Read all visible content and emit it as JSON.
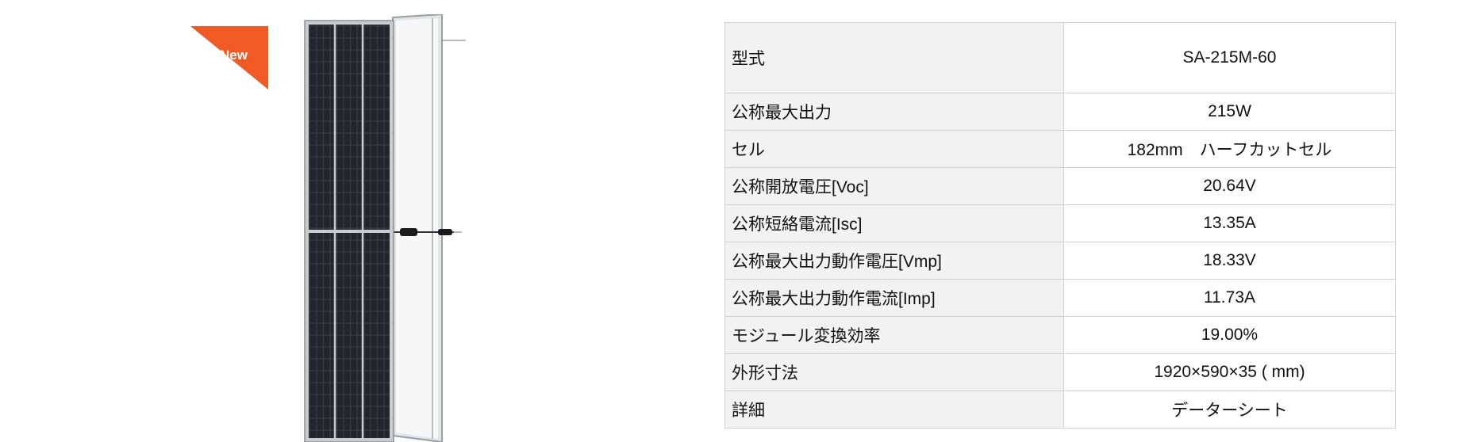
{
  "badge": {
    "text": "New",
    "color": "#f15a24"
  },
  "product_image": {
    "description_icon": "solar-panel-icon"
  },
  "specs": [
    {
      "label": "型式",
      "value": "SA-215M-60"
    },
    {
      "label": "公称最大出力",
      "value": "215W"
    },
    {
      "label": "セル",
      "value": "182mm　ハーフカットセル"
    },
    {
      "label": "公称開放電圧[Voc]",
      "value": "20.64V"
    },
    {
      "label": "公称短絡電流[Isc]",
      "value": "13.35A"
    },
    {
      "label": "公称最大出力動作電圧[Vmp]",
      "value": "18.33V"
    },
    {
      "label": "公称最大出力動作電流[Imp]",
      "value": "11.73A"
    },
    {
      "label": "モジュール変換効率",
      "value": "19.00%"
    },
    {
      "label": "外形寸法",
      "value": "1920×590×35 ( mm)"
    },
    {
      "label": "詳細",
      "value": "データーシート",
      "link": true
    }
  ]
}
